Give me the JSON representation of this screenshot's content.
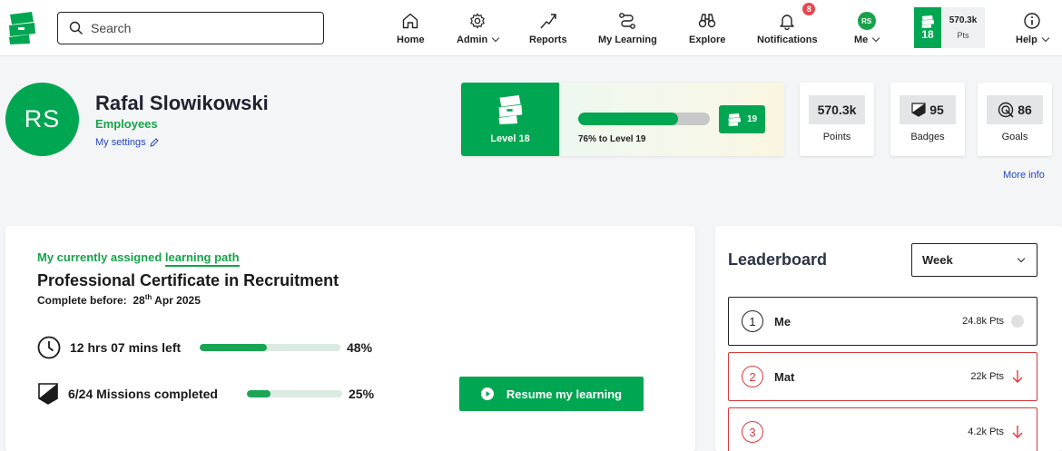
{
  "nav": {
    "search_placeholder": "Search",
    "items": [
      {
        "label": "Home",
        "icon": "home-icon"
      },
      {
        "label": "Admin",
        "icon": "gear-icon"
      },
      {
        "label": "Reports",
        "icon": "trend-up-icon"
      },
      {
        "label": "My Learning",
        "icon": "route-icon"
      },
      {
        "label": "Explore",
        "icon": "binoculars-icon"
      },
      {
        "label": "Notifications",
        "icon": "bell-icon",
        "badge": "8"
      },
      {
        "label": "Me",
        "icon": "avatar",
        "initials": "RS"
      },
      {
        "label": "Help",
        "icon": "info-icon"
      }
    ],
    "points_widget": {
      "level": "18",
      "points": "570.3k",
      "unit": "Pts"
    }
  },
  "profile": {
    "initials": "RS",
    "name": "Rafal Slowikowski",
    "role": "Employees",
    "settings_link": "My settings"
  },
  "level": {
    "label": "Level 18",
    "progress_percent": 76,
    "progress_text": "76% to Level 19",
    "next_level": "19"
  },
  "stats": [
    {
      "value": "570.3k",
      "caption": "Points",
      "icon": ""
    },
    {
      "value": "95",
      "caption": "Badges",
      "icon": "badge-icon"
    },
    {
      "value": "86",
      "caption": "Goals",
      "icon": "target-icon"
    }
  ],
  "more_info": "More info",
  "learning_path": {
    "assigned_prefix": "My currently assigned",
    "assigned_link": "learning path",
    "title": "Professional Certificate in Recruitment",
    "due_label": "Complete before:",
    "due_day": "28",
    "due_suffix": "th",
    "due_rest": "Apr 2025",
    "time_left": "12 hrs 07 mins left",
    "time_percent": 48,
    "time_percent_label": "48%",
    "missions": "6/24 Missions completed",
    "missions_percent": 25,
    "missions_percent_label": "25%",
    "resume_label": "Resume my learning"
  },
  "leaderboard": {
    "title": "Leaderboard",
    "period": "Week",
    "rows": [
      {
        "rank": "1",
        "name": "Me",
        "points": "24.8k Pts",
        "trend": "same"
      },
      {
        "rank": "2",
        "name": "Mat",
        "points": "22k Pts",
        "trend": "down"
      },
      {
        "rank": "3",
        "name": "",
        "points": "4.2k Pts",
        "trend": "down"
      }
    ]
  },
  "colors": {
    "brand_green": "#00a651",
    "link_blue": "#2546c2",
    "down_red": "#d93a3a"
  }
}
